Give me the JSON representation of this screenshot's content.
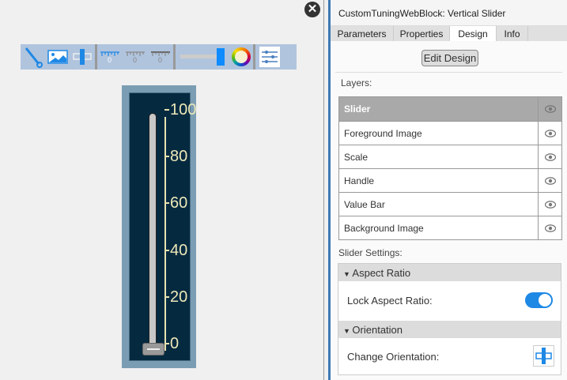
{
  "toolbar": {
    "icons": [
      "needle-icon",
      "image-icon",
      "handle-icon",
      "scale-ticks-icon",
      "scale-ticks-gray-icon",
      "scale-ticks-dark-icon",
      "value-bar-icon",
      "color-wheel-icon",
      "settings-sliders-icon"
    ]
  },
  "slider": {
    "value": 0,
    "min": 0,
    "max": 100,
    "ticks": [
      "100",
      "80",
      "60",
      "40",
      "20",
      "0"
    ]
  },
  "panel": {
    "title": "CustomTuningWebBlock: Vertical Slider",
    "tabs": [
      "Parameters",
      "Properties",
      "Design",
      "Info"
    ],
    "active_tab": "Design",
    "edit_design": "Edit Design",
    "layers_label": "Layers:",
    "layers": [
      "Slider",
      "Foreground Image",
      "Scale",
      "Handle",
      "Value Bar",
      "Background Image"
    ],
    "settings_label": "Slider Settings:",
    "aspect": {
      "header": "Aspect Ratio",
      "label": "Lock Aspect Ratio:",
      "on": true
    },
    "orientation": {
      "header": "Orientation",
      "label": "Change Orientation:"
    }
  },
  "colors": {
    "accent": "#1e88e5",
    "slider_bg": "#052a40",
    "scale": "#eee8b8"
  }
}
